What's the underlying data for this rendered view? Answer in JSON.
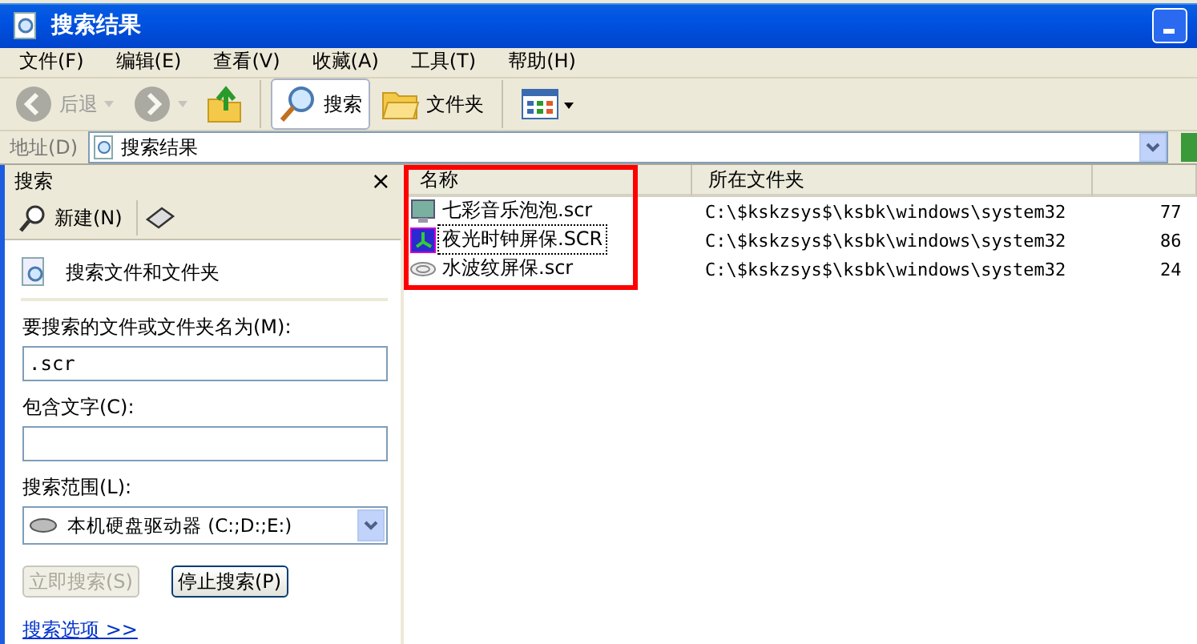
{
  "window": {
    "title": "搜索结果"
  },
  "menu": [
    "文件(F)",
    "编辑(E)",
    "查看(V)",
    "收藏(A)",
    "工具(T)",
    "帮助(H)"
  ],
  "toolbar": [
    {
      "kind": "back",
      "label": "后退",
      "disabled": true,
      "selected": false
    },
    {
      "kind": "forward",
      "disabled": true,
      "selected": false
    },
    {
      "kind": "up",
      "disabled": false,
      "selected": false
    },
    {
      "kind": "search",
      "label": "搜索",
      "disabled": false,
      "selected": true
    },
    {
      "kind": "folders",
      "label": "文件夹",
      "disabled": false,
      "selected": false
    },
    {
      "kind": "views",
      "disabled": false,
      "selected": false
    }
  ],
  "address": {
    "label": "地址(D)",
    "value": "搜索结果"
  },
  "search_pane": {
    "title": "搜索",
    "close": "×",
    "new_label": "新建(N)",
    "heading": "搜索文件和文件夹",
    "name_label": "要搜索的文件或文件夹名为(M):",
    "name_value": ".scr",
    "text_label": "包含文字(C):",
    "scope_label": "搜索范围(L):",
    "scope_value": "本机硬盘驱动器 (C:;D:;E:)",
    "search_button": {
      "label": "立即搜索(S)",
      "disabled": true
    },
    "stop_button": {
      "label": "停止搜索(P)",
      "disabled": false
    },
    "options_link": "搜索选项 >>"
  },
  "table": {
    "columns": [
      "名称",
      "所在文件夹"
    ],
    "rows": [
      {
        "name": "七彩音乐泡泡.scr",
        "folder": "C:\\$kskzsys$\\ksbk\\windows\\system32",
        "column_3": "77",
        "kind": "monitor",
        "focused": false
      },
      {
        "name": "夜光时钟屏保.SCR",
        "folder": "C:\\$kskzsys$\\ksbk\\windows\\system32",
        "column_3": "86",
        "kind": "clock",
        "focused": true
      },
      {
        "name": "水波纹屏保.scr",
        "folder": "C:\\$kskzsys$\\ksbk\\windows\\system32",
        "column_3": "24",
        "kind": "ripple",
        "focused": false
      }
    ]
  }
}
